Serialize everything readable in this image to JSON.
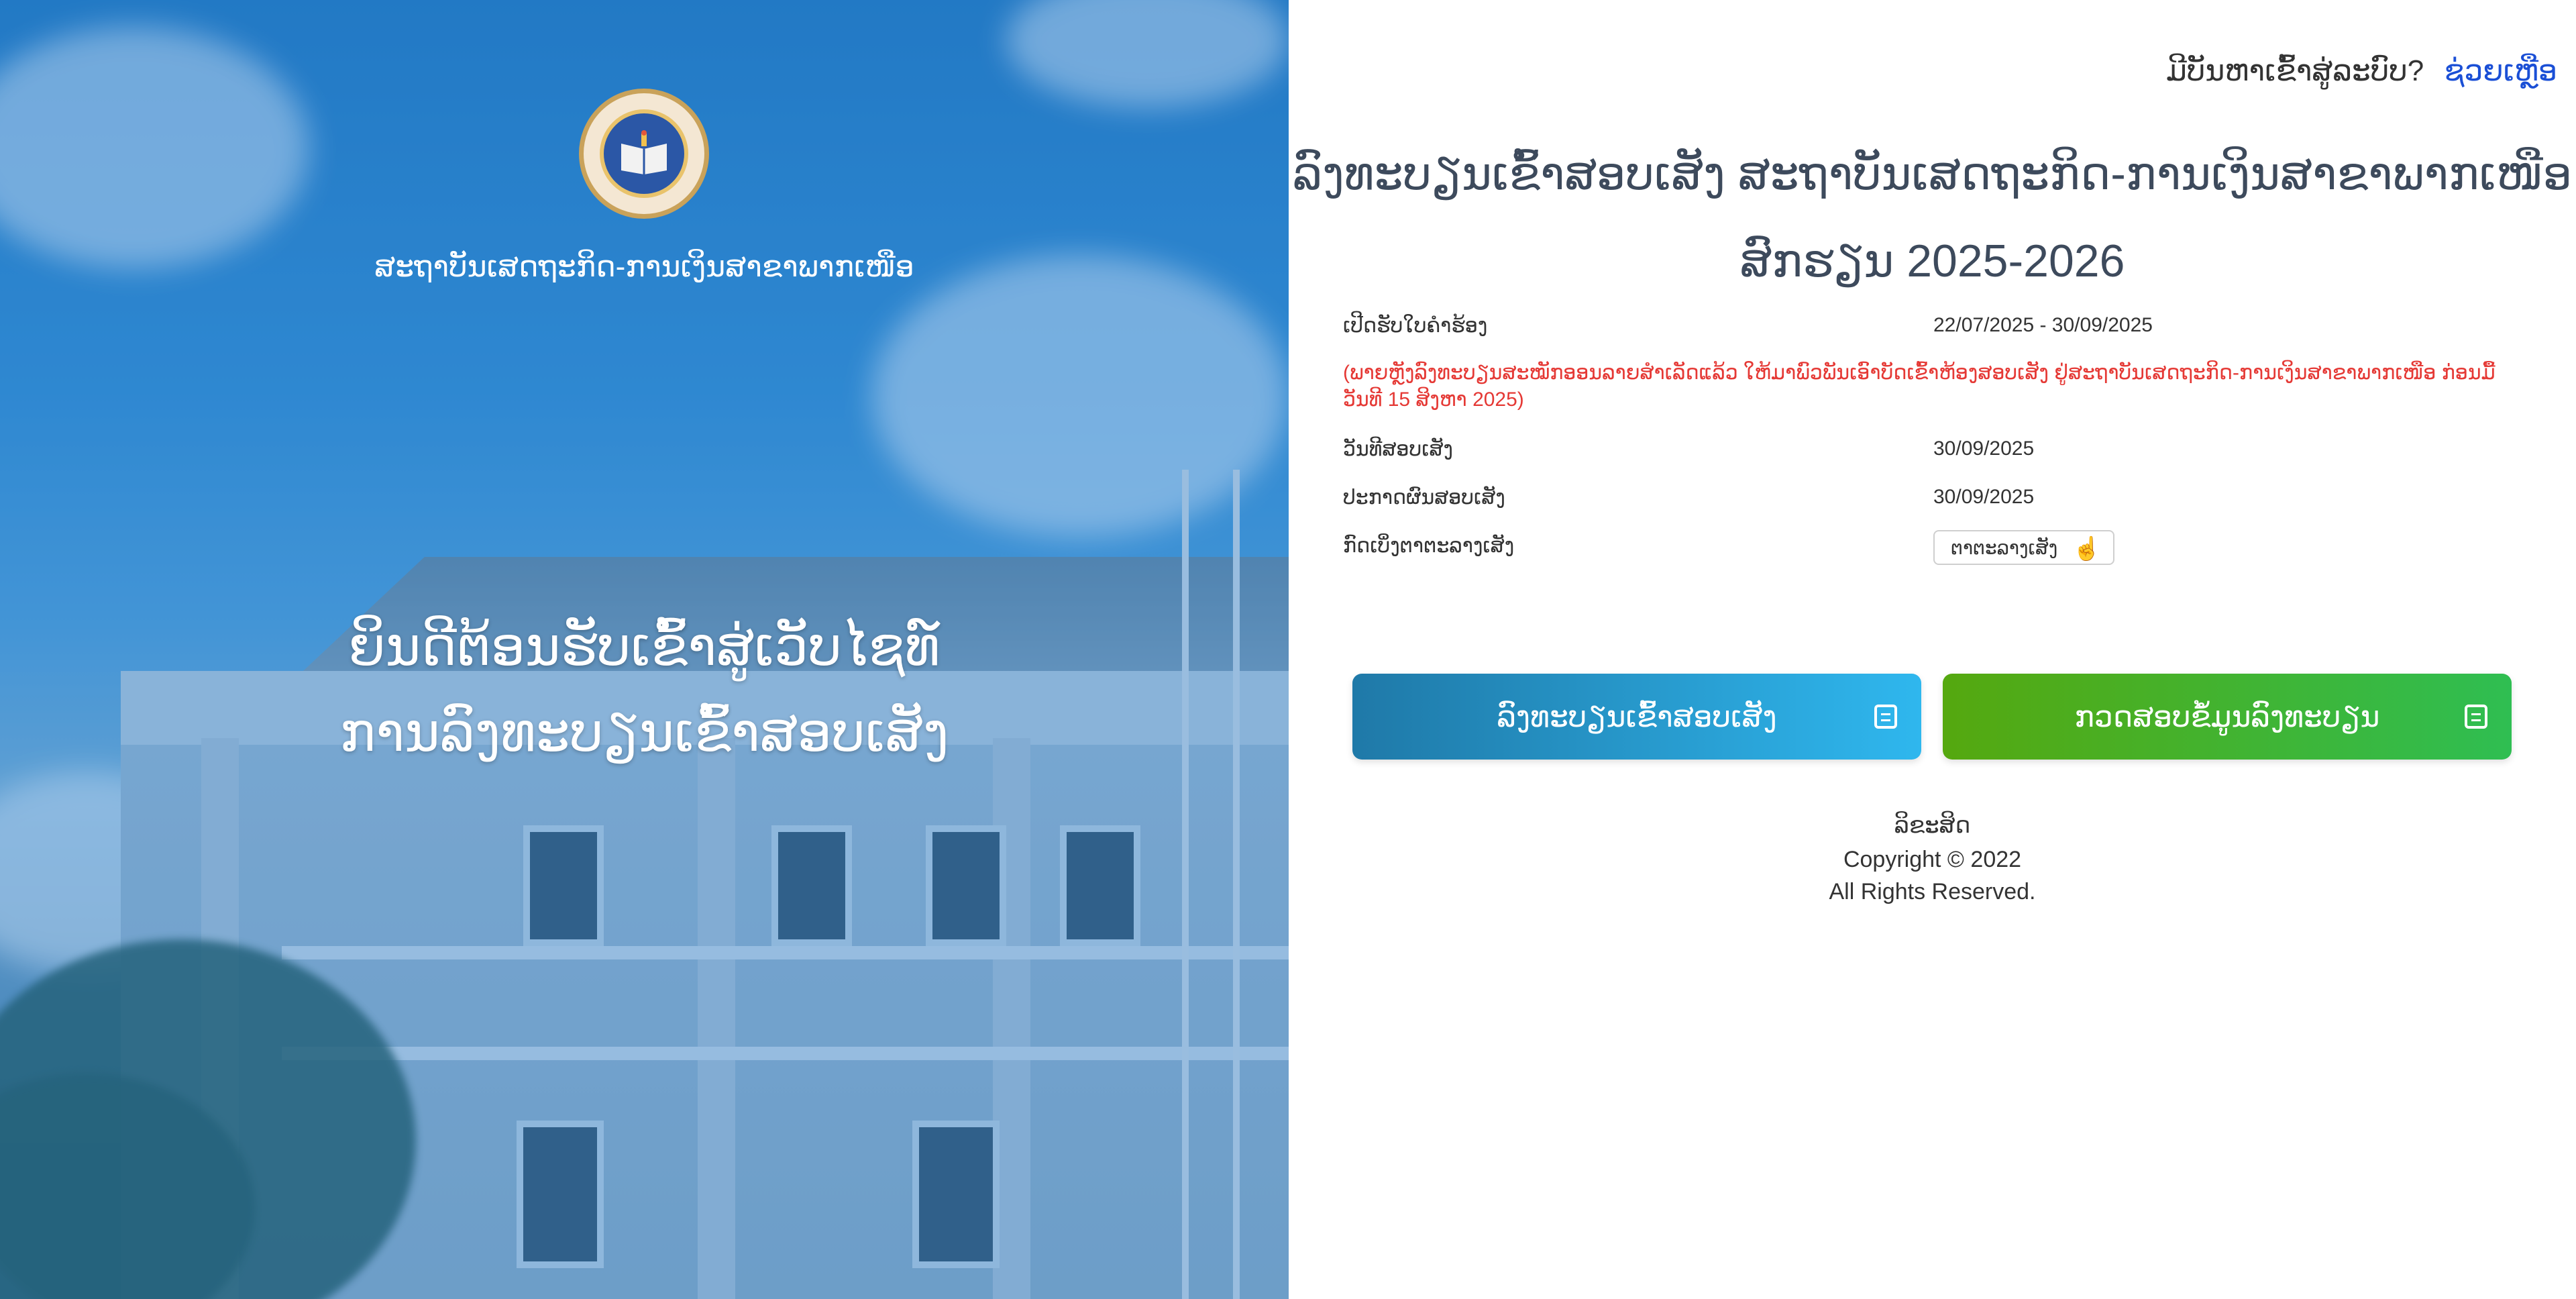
{
  "hero": {
    "logo_icon": "institute-seal-icon",
    "institute_name": "ສະຖາບັນເສດຖະກິດ-ການເງິນສາຂາພາກເໜືອ",
    "welcome_line1": "ຍິນດີຕ້ອນຮັບເຂົ້າສູ່ເວັບໄຊທ໌",
    "welcome_line2": "ການລົງທະບຽນເຂົ້າສອບເສັງ"
  },
  "header": {
    "help_question": "ມີບັນຫາເຂົ້າສູ່ລະບົບ?",
    "help_link": "ຊ່ວຍເຫຼືອ"
  },
  "main": {
    "title_line1": "ລົງທະບຽນເຂົ້າສອບເສັງ ສະຖາບັນເສດຖະກິດ-ການເງິນສາຂາພາກເໜືອ",
    "title_line2": "ສົກຮຽນ 2025-2026",
    "application_label": "ເປີດຮັບໃບຄຳຮ້ອງ",
    "application_period": "22/07/2025 - 30/09/2025",
    "notice": "(ພາຍຫຼັງລົງທະບຽນສະໝັກອອນລາຍສຳເລັດແລ້ວ ໃຫ້ມາພົວພັນເອົາບັດເຂົ້າຫ້ອງສອບເສັງ ຢູ່ສະຖາບັນເສດຖະກິດ-ການເງິນສາຂາພາກເໜືອ ກ່ອນມື້ວັນທີ 15 ສິງຫາ 2025)",
    "exam_date_label": "ວັນທີສອບເສັງ",
    "exam_date": "30/09/2025",
    "result_label": "ປະກາດຜົນສອບເສັງ",
    "result_date": "30/09/2025",
    "schedule_label": "ກົດເບິ່ງຕາຕະລາງເສັງ",
    "schedule_button": "ຕາຕະລາງເສັງ",
    "schedule_icon": "pointer-hand-icon"
  },
  "actions": {
    "register": "ລົງທະບຽນເຂົ້າສອບເສັງ",
    "register_icon": "form-icon",
    "check": "ກວດສອບຂໍ້ມູນລົງທະບຽນ",
    "check_icon": "edit-icon"
  },
  "footer": {
    "line1": "ລິຂະສິດ",
    "line2": "Copyright © 2022",
    "line3": "All Rights Reserved."
  },
  "colors": {
    "register_button": "#2fb7ee",
    "check_button": "#3cb84a",
    "notice": "#e53935",
    "help_link": "#1a4fd6"
  }
}
